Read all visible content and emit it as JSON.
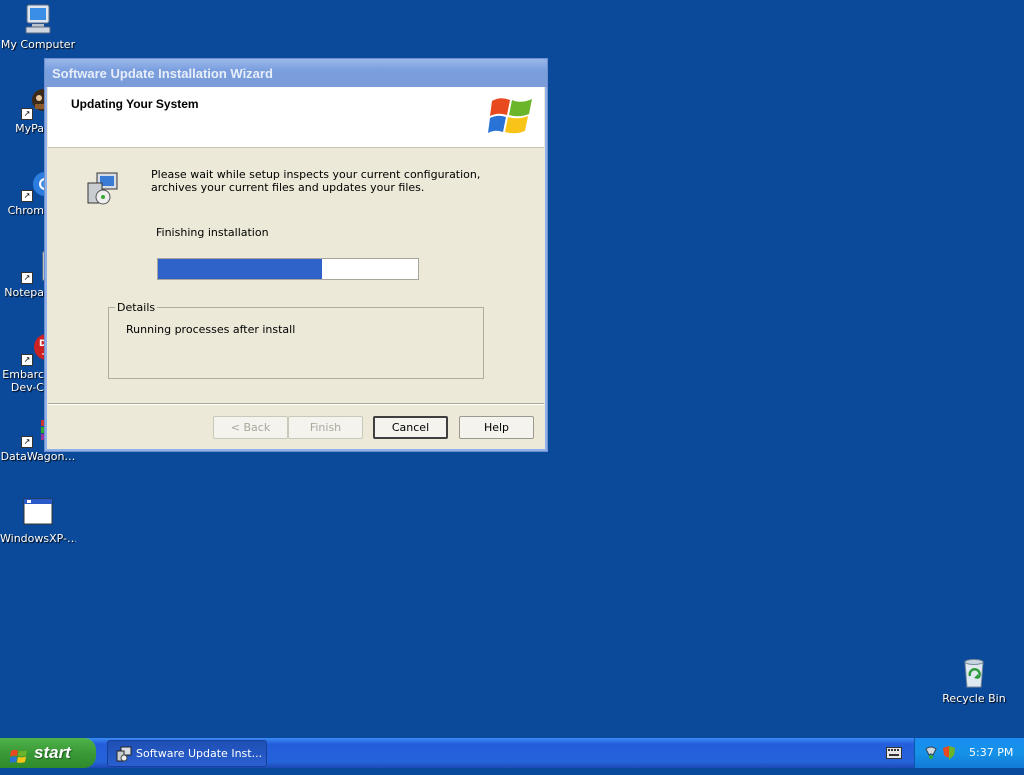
{
  "desktop": {
    "icons": [
      {
        "label": "My Computer",
        "icon": "my-computer-icon"
      },
      {
        "label": "MyPa",
        "icon": "mypaint-icon"
      },
      {
        "label": "Chrom",
        "icon": "chrome-icon"
      },
      {
        "label": "Notepa",
        "icon": "notepad-icon"
      },
      {
        "label": "Embarc",
        "label2": "Dev-C",
        "icon": "devcpp-icon"
      },
      {
        "label": "DataWagon…",
        "icon": "datawagon-icon"
      },
      {
        "label": "WindowsXP-…",
        "icon": "window-app-icon"
      },
      {
        "label": "Recycle Bin",
        "icon": "recycle-bin-icon"
      }
    ]
  },
  "dialog": {
    "title": "Software Update Installation Wizard",
    "header_title": "Updating Your System",
    "body_text": "Please wait while setup inspects your current configuration, archives your current files and updates your files.",
    "status_text": "Finishing installation",
    "progress": 0.63,
    "details_label": "Details",
    "details_text": "Running processes after install",
    "buttons": {
      "back": "< Back",
      "finish": "Finish",
      "cancel": "Cancel",
      "help": "Help"
    }
  },
  "taskbar": {
    "start_label": "start",
    "task_label": "Software Update Inst...",
    "clock": "5:37 PM"
  },
  "colors": {
    "desktop": "#0b4a9b",
    "progress_fill": "#2f63c9",
    "taskbar": "#245edb",
    "start": "#3a9a37"
  }
}
